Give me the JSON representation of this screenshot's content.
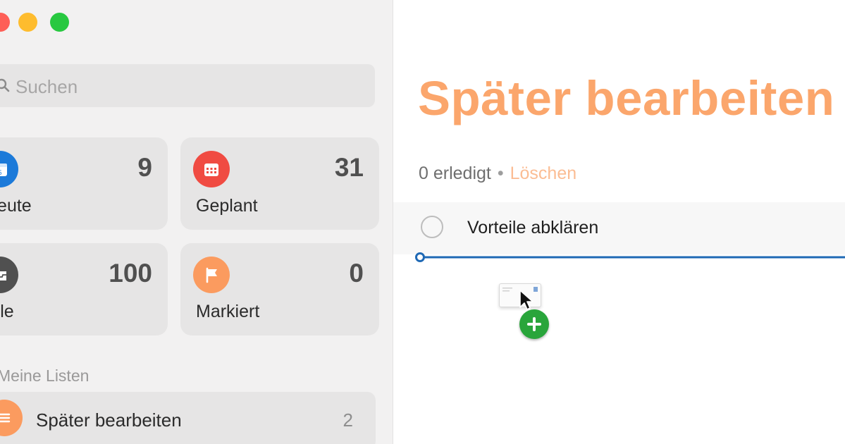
{
  "window": {
    "controls": [
      "close",
      "minimize",
      "zoom"
    ]
  },
  "sidebar": {
    "search": {
      "placeholder": "Suchen",
      "icon": "search-icon"
    },
    "smart_lists": [
      {
        "label": "Heute",
        "count": "9",
        "icon": "calendar-today-icon",
        "color": "#1c7ad9"
      },
      {
        "label": "Geplant",
        "count": "31",
        "icon": "calendar-grid-icon",
        "color": "#f04b42"
      },
      {
        "label": "Alle",
        "count": "100",
        "icon": "tray-icon",
        "color": "#505050"
      },
      {
        "label": "Markiert",
        "count": "0",
        "icon": "flag-icon",
        "color": "#fb9b5f"
      }
    ],
    "section_title": "Meine Listen",
    "lists": [
      {
        "name": "Später bearbeiten",
        "count": "2",
        "icon": "list-icon",
        "color": "#fb9b5f"
      }
    ]
  },
  "main": {
    "title": "Später bearbeiten",
    "title_color": "#fba66c",
    "completed": "0 erledigt",
    "separator": "•",
    "clear_label": "Löschen",
    "tasks": [
      {
        "title": "Vorteile abklären",
        "done": false
      }
    ],
    "drop_indicator_color": "#1f69b5",
    "drag": {
      "badge": "plus-icon",
      "badge_color": "#29a53b"
    }
  }
}
